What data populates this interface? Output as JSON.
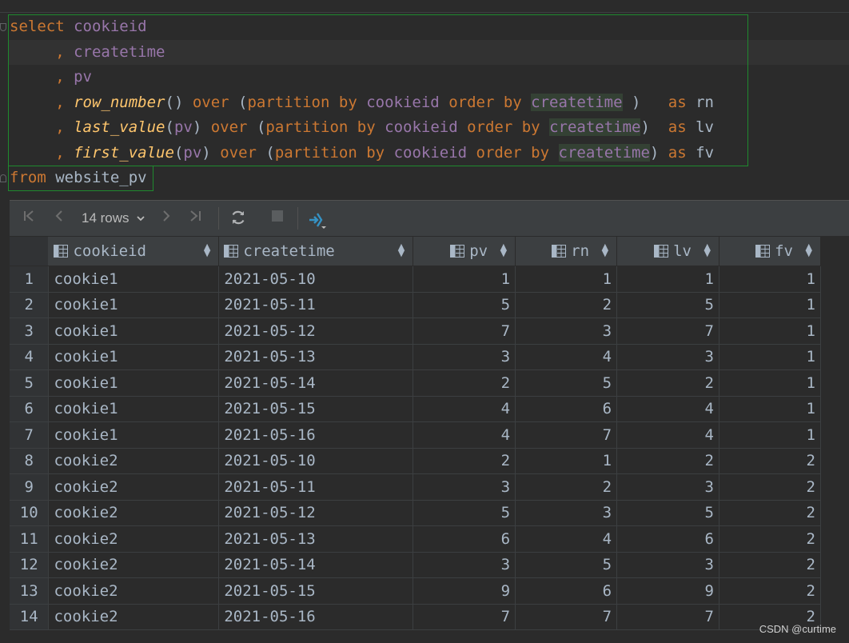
{
  "editor": {
    "tokens": [
      [
        [
          "kw",
          "select"
        ],
        [
          "pl",
          " "
        ],
        [
          "id",
          "cookieid"
        ]
      ],
      [
        [
          "pl",
          "     "
        ],
        [
          "kw",
          ","
        ],
        [
          "pl",
          " "
        ],
        [
          "id",
          "createtime"
        ]
      ],
      [
        [
          "pl",
          "     "
        ],
        [
          "kw",
          ","
        ],
        [
          "pl",
          " "
        ],
        [
          "id",
          "pv"
        ]
      ],
      [
        [
          "pl",
          "     "
        ],
        [
          "kw",
          ","
        ],
        [
          "pl",
          " "
        ],
        [
          "fn",
          "row_number"
        ],
        [
          "pl",
          "() "
        ],
        [
          "kw",
          "over"
        ],
        [
          "pl",
          " ("
        ],
        [
          "kw",
          "partition by"
        ],
        [
          "pl",
          " "
        ],
        [
          "id",
          "cookieid"
        ],
        [
          "pl",
          " "
        ],
        [
          "kw",
          "order by"
        ],
        [
          "pl",
          " "
        ],
        [
          "idref",
          "createtime"
        ],
        [
          "pl",
          " )   "
        ],
        [
          "kw",
          "as"
        ],
        [
          "pl",
          " rn"
        ]
      ],
      [
        [
          "pl",
          "     "
        ],
        [
          "kw",
          ","
        ],
        [
          "pl",
          " "
        ],
        [
          "fn",
          "last_value"
        ],
        [
          "pl",
          "("
        ],
        [
          "id",
          "pv"
        ],
        [
          "pl",
          ") "
        ],
        [
          "kw",
          "over"
        ],
        [
          "pl",
          " ("
        ],
        [
          "kw",
          "partition by"
        ],
        [
          "pl",
          " "
        ],
        [
          "id",
          "cookieid"
        ],
        [
          "pl",
          " "
        ],
        [
          "kw",
          "order by"
        ],
        [
          "pl",
          " "
        ],
        [
          "idref",
          "createtime"
        ],
        [
          "pl",
          ")  "
        ],
        [
          "kw",
          "as"
        ],
        [
          "pl",
          " lv"
        ]
      ],
      [
        [
          "pl",
          "     "
        ],
        [
          "kw",
          ","
        ],
        [
          "pl",
          " "
        ],
        [
          "fn",
          "first_value"
        ],
        [
          "pl",
          "("
        ],
        [
          "id",
          "pv"
        ],
        [
          "pl",
          ") "
        ],
        [
          "kw",
          "over"
        ],
        [
          "pl",
          " ("
        ],
        [
          "kw",
          "partition by"
        ],
        [
          "pl",
          " "
        ],
        [
          "id",
          "cookieid"
        ],
        [
          "pl",
          " "
        ],
        [
          "kw",
          "order by"
        ],
        [
          "pl",
          " "
        ],
        [
          "idref",
          "createtime"
        ],
        [
          "pl",
          ") "
        ],
        [
          "kw",
          "as"
        ],
        [
          "pl",
          " fv"
        ]
      ],
      [
        [
          "kw",
          "from"
        ],
        [
          "pl",
          " website_pv"
        ]
      ]
    ],
    "highlighted_line": 1
  },
  "toolbar": {
    "rows_label": "14 rows",
    "icons": [
      "first-page-icon",
      "prev-page-icon",
      "rows-dropdown-icon",
      "next-page-icon",
      "last-page-icon",
      "refresh-icon",
      "stop-icon",
      "pin-tab-icon"
    ]
  },
  "grid": {
    "columns": [
      {
        "name": "cookieid",
        "align": "left"
      },
      {
        "name": "createtime",
        "align": "left"
      },
      {
        "name": "pv",
        "align": "right"
      },
      {
        "name": "rn",
        "align": "right"
      },
      {
        "name": "lv",
        "align": "right"
      },
      {
        "name": "fv",
        "align": "right"
      }
    ],
    "rows": [
      [
        "1",
        "cookie1",
        "2021-05-10",
        "1",
        "1",
        "1",
        "1"
      ],
      [
        "2",
        "cookie1",
        "2021-05-11",
        "5",
        "2",
        "5",
        "1"
      ],
      [
        "3",
        "cookie1",
        "2021-05-12",
        "7",
        "3",
        "7",
        "1"
      ],
      [
        "4",
        "cookie1",
        "2021-05-13",
        "3",
        "4",
        "3",
        "1"
      ],
      [
        "5",
        "cookie1",
        "2021-05-14",
        "2",
        "5",
        "2",
        "1"
      ],
      [
        "6",
        "cookie1",
        "2021-05-15",
        "4",
        "6",
        "4",
        "1"
      ],
      [
        "7",
        "cookie1",
        "2021-05-16",
        "4",
        "7",
        "4",
        "1"
      ],
      [
        "8",
        "cookie2",
        "2021-05-10",
        "2",
        "1",
        "2",
        "2"
      ],
      [
        "9",
        "cookie2",
        "2021-05-11",
        "3",
        "2",
        "3",
        "2"
      ],
      [
        "10",
        "cookie2",
        "2021-05-12",
        "5",
        "3",
        "5",
        "2"
      ],
      [
        "11",
        "cookie2",
        "2021-05-13",
        "6",
        "4",
        "6",
        "2"
      ],
      [
        "12",
        "cookie2",
        "2021-05-14",
        "3",
        "5",
        "3",
        "2"
      ],
      [
        "13",
        "cookie2",
        "2021-05-15",
        "9",
        "6",
        "9",
        "2"
      ],
      [
        "14",
        "cookie2",
        "2021-05-16",
        "7",
        "7",
        "7",
        "2"
      ]
    ]
  },
  "watermark": "CSDN @curtime",
  "colors": {
    "keyword": "#cc7832",
    "identifier": "#9876aa",
    "function": "#ffc66d",
    "selection_border": "#1f8a2e"
  }
}
